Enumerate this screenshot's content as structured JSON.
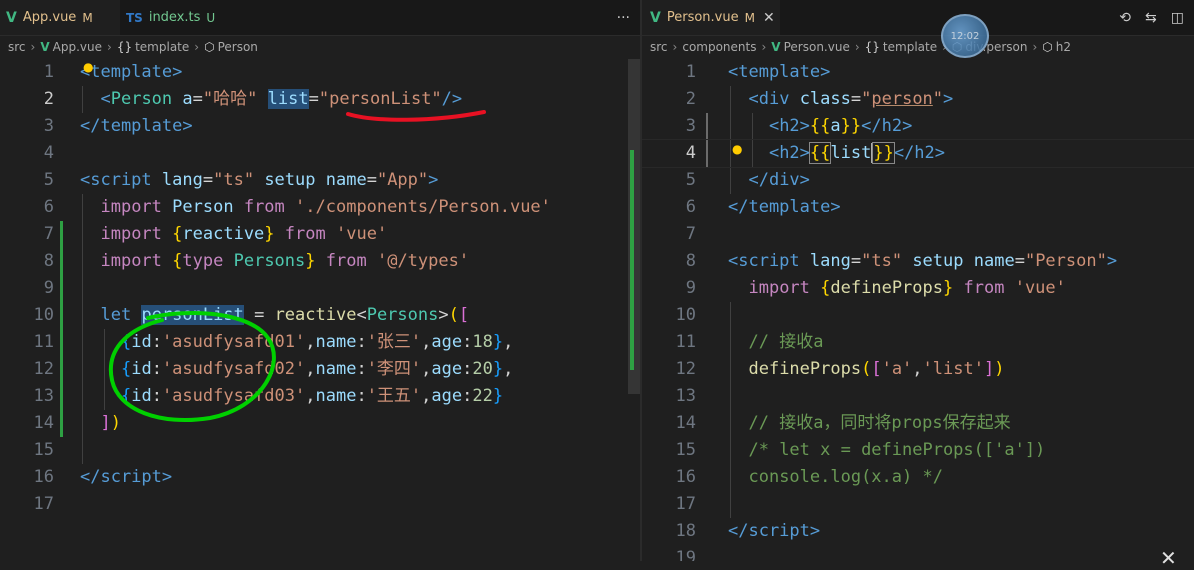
{
  "left": {
    "tabs": [
      {
        "icon": "V",
        "label": "App.vue",
        "badge": "M"
      },
      {
        "icon": "TS",
        "label": "index.ts",
        "badge": "U"
      }
    ],
    "breadcrumb": [
      "src",
      "App.vue",
      "template",
      "Person"
    ],
    "line_numbers": [
      "1",
      "2",
      "3",
      "4",
      "5",
      "6",
      "7",
      "8",
      "9",
      "10",
      "11",
      "12",
      "13",
      "14",
      "15",
      "16",
      "17"
    ]
  },
  "right": {
    "tabs": [
      {
        "icon": "V",
        "label": "Person.vue",
        "badge": "M"
      }
    ],
    "breadcrumb": [
      "src",
      "components",
      "Person.vue",
      "template",
      "div.person",
      "h2"
    ],
    "line_numbers": [
      "1",
      "2",
      "3",
      "4",
      "5",
      "6",
      "7",
      "8",
      "9",
      "10",
      "11",
      "12",
      "13",
      "14",
      "15",
      "16",
      "17",
      "18",
      "19"
    ]
  },
  "avatar_text": "12:02",
  "colors": {
    "accent_green": "#41b883",
    "annotation_red": "#e81123",
    "annotation_green": "#00d000"
  }
}
